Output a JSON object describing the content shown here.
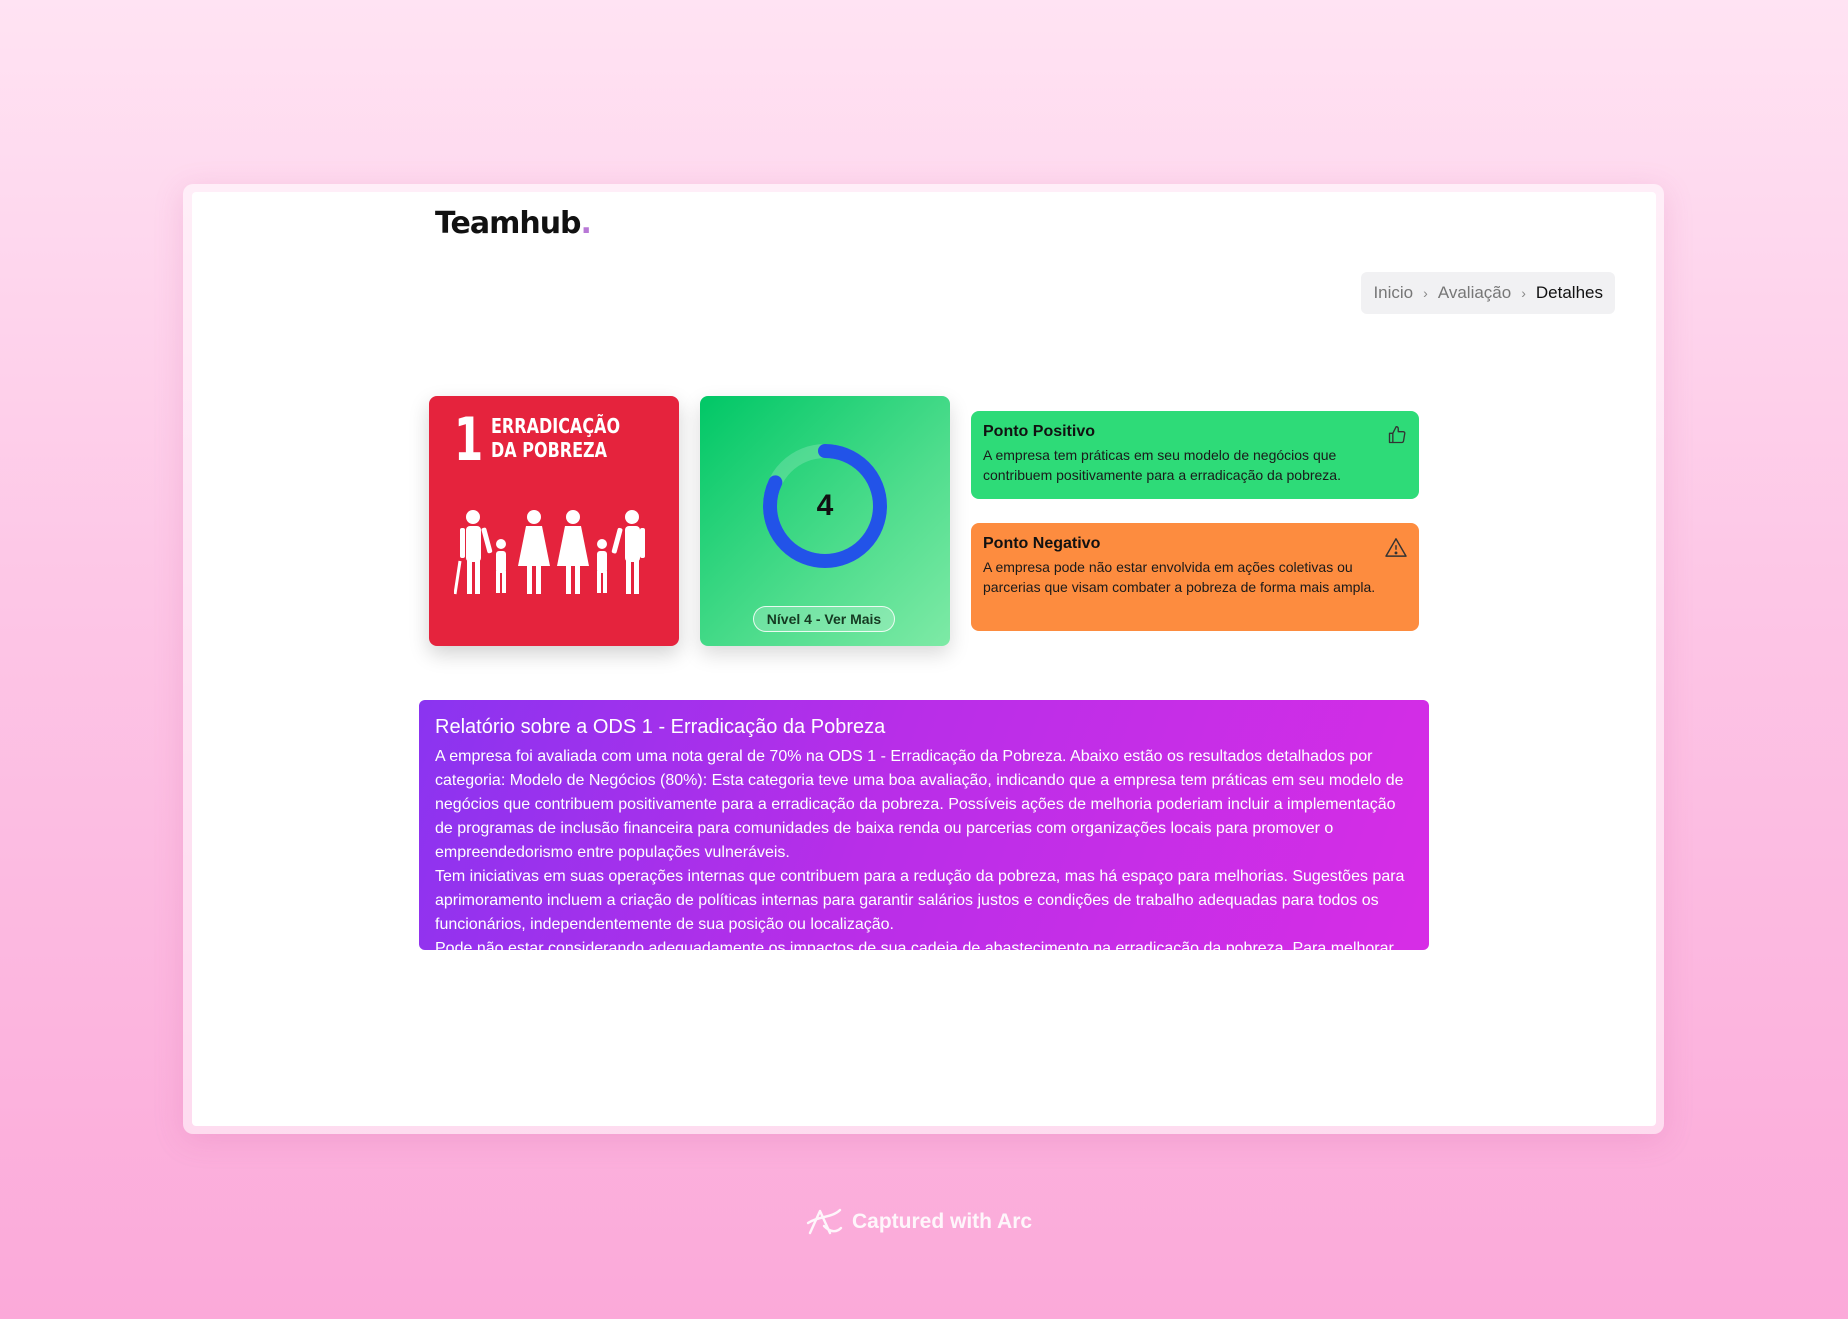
{
  "app": {
    "logo_text": "Teamhub",
    "logo_dot": "."
  },
  "breadcrumb": {
    "items": [
      "Inicio",
      "Avaliação",
      "Detalhes"
    ],
    "separator": "›"
  },
  "sdg_card": {
    "number": "1",
    "title_line1": "ERRADICAÇÃO",
    "title_line2": "DA POBREZA",
    "color": "#e5233d",
    "icon": "family-icon"
  },
  "score_card": {
    "value": "4",
    "progress_fraction": 0.82,
    "button_label": "Nível 4 - Ver Mais",
    "ring_color": "#2253e8"
  },
  "positive": {
    "title": "Ponto Positivo",
    "text": "A empresa tem práticas em seu modelo de negócios que contribuem positivamente para a erradicação da pobreza.",
    "icon": "thumbs-up-icon",
    "color": "#2edb78"
  },
  "negative": {
    "title": "Ponto Negativo",
    "text": "A empresa pode não estar envolvida em ações coletivas ou parcerias que visam combater a pobreza de forma mais ampla.",
    "icon": "warning-icon",
    "color": "#fd8c3f"
  },
  "report": {
    "title": "Relatório sobre a ODS 1 - Erradicação da Pobreza",
    "paragraphs": [
      "A empresa foi avaliada com uma nota geral de 70% na ODS 1 - Erradicação da Pobreza. Abaixo estão os resultados detalhados por categoria: Modelo de Negócios (80%): Esta categoria teve uma boa avaliação, indicando que a empresa tem práticas em seu modelo de negócios que contribuem positivamente para a erradicação da pobreza. Possíveis ações de melhoria poderiam incluir a implementação de programas de inclusão financeira para comunidades de baixa renda ou parcerias com organizações locais para promover o empreendedorismo entre populações vulneráveis.",
      "Tem iniciativas em suas operações internas que contribuem para a redução da pobreza, mas há espaço para melhorias. Sugestões para aprimoramento incluem a criação de políticas internas para garantir salários justos e condições de trabalho adequadas para todos os funcionários, independentemente de sua posição ou localização.",
      "Pode não estar considerando adequadamente os impactos de sua cadeia de abastecimento na erradicação da pobreza. Para melhorar"
    ]
  },
  "footer": {
    "badge_text": "Captured with Arc",
    "icon": "arc-logo-icon"
  }
}
